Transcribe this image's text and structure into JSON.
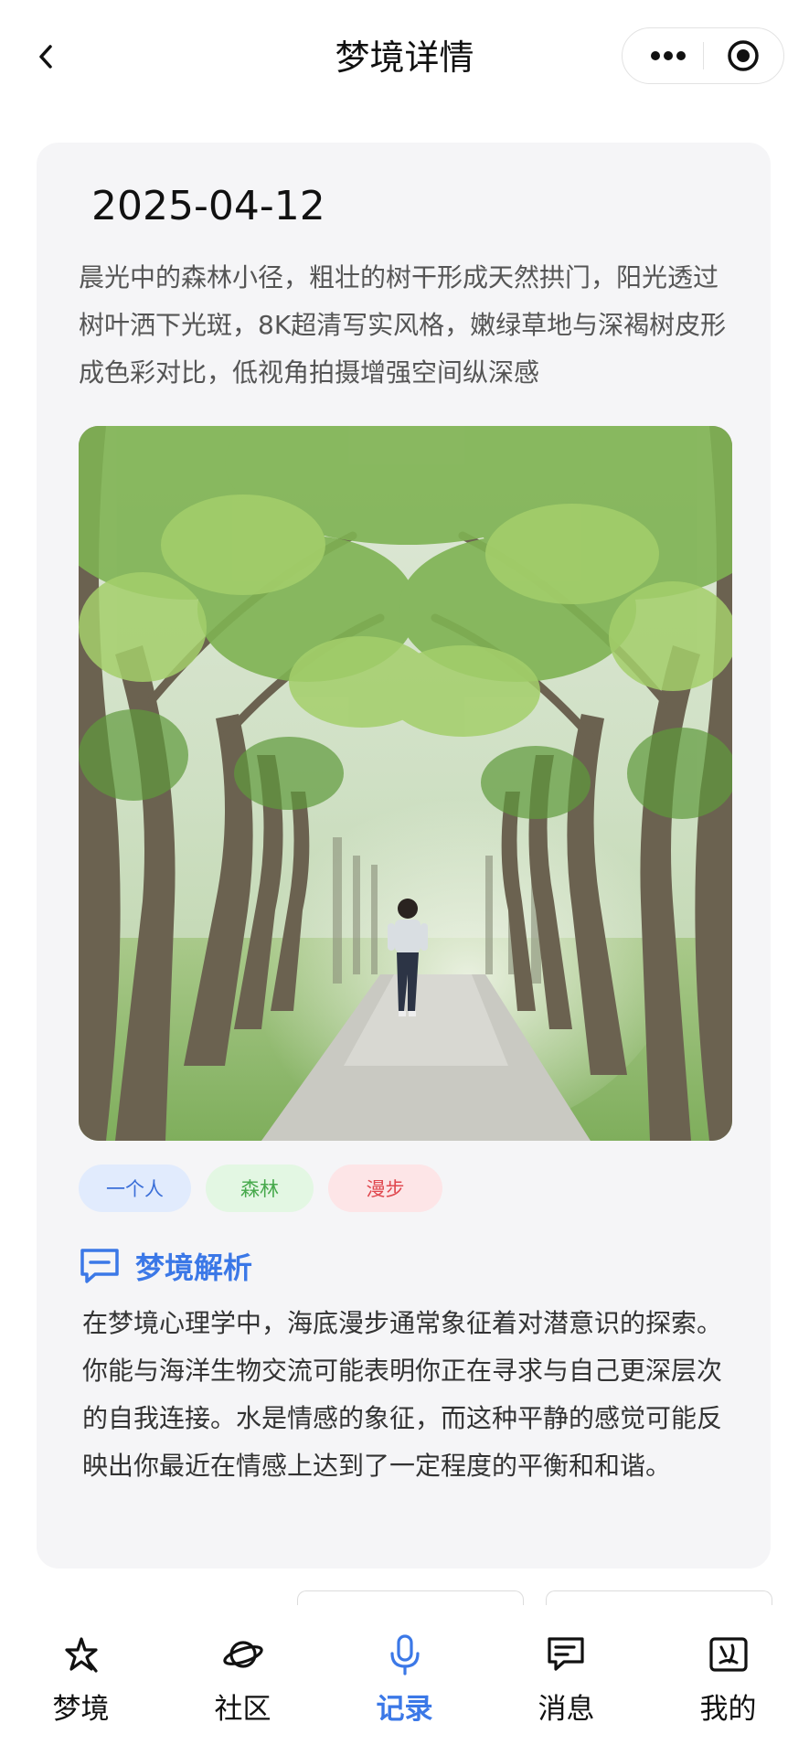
{
  "header": {
    "title": "梦境详情",
    "back_icon": "chevron-left-icon",
    "more_icon": "more-dots-icon",
    "record_icon": "target-circle-icon"
  },
  "dream": {
    "date": "2025-04-12",
    "description": "晨光中的森林小径，粗壮的树干形成天然拱门，阳光透过树叶洒下光斑，8K超清写实风格，嫩绿草地与深褐树皮形成色彩对比，低视角拍摄增强空间纵深感",
    "image_alt": "森林小径中散步的人",
    "tags": [
      {
        "label": "一个人",
        "color": "#3b6fd8",
        "bg": "#e1ebfd"
      },
      {
        "label": "森林",
        "color": "#46a94b",
        "bg": "#e3f7e3"
      },
      {
        "label": "漫步",
        "color": "#e0484f",
        "bg": "#fde5e7"
      }
    ],
    "analysis_title": "梦境解析",
    "analysis_icon": "chat-bubble-icon",
    "analysis_text": "在梦境心理学中，海底漫步通常象征着对潜意识的探索。你能与海洋生物交流可能表明你正在寻求与自己更深层次的自我连接。水是情感的象征，而这种平静的感觉可能反映出你最近在情感上达到了一定程度的平衡和和谐。"
  },
  "tabbar": {
    "active": "记录",
    "accent": "#3b78e7",
    "items": [
      {
        "label": "梦境",
        "icon": "sparkle-star-icon"
      },
      {
        "label": "社区",
        "icon": "planet-icon"
      },
      {
        "label": "记录",
        "icon": "microphone-icon"
      },
      {
        "label": "消息",
        "icon": "message-icon"
      },
      {
        "label": "我的",
        "icon": "profile-icon"
      }
    ]
  }
}
